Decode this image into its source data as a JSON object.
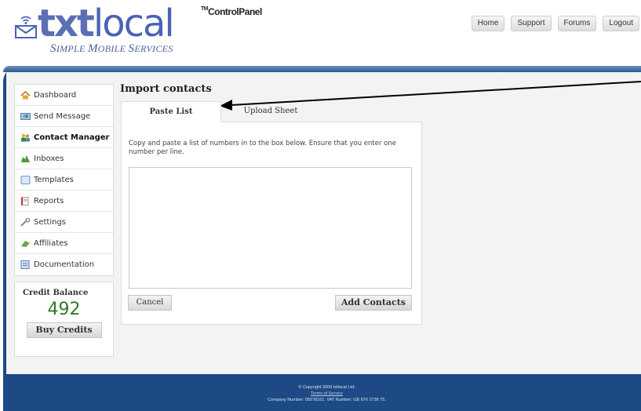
{
  "logo": {
    "brand_bold": "txt",
    "brand_light": "local",
    "product": "ControlPanel",
    "product_prefix": "TM",
    "tagline_s": "S",
    "tagline_1": "IMPLE ",
    "tagline_m": "M",
    "tagline_2": "OBILE ",
    "tagline_sv": "S",
    "tagline_3": "ERVICES"
  },
  "topnav": {
    "items": [
      {
        "label": "Home"
      },
      {
        "label": "Support"
      },
      {
        "label": "Forums"
      },
      {
        "label": "Logout"
      }
    ]
  },
  "sidebar": {
    "items": [
      {
        "label": "Dashboard",
        "icon": "home-icon"
      },
      {
        "label": "Send Message",
        "icon": "send-message-icon"
      },
      {
        "label": "Contact Manager",
        "icon": "contacts-icon",
        "active": true
      },
      {
        "label": "Inboxes",
        "icon": "inbox-icon"
      },
      {
        "label": "Templates",
        "icon": "template-icon"
      },
      {
        "label": "Reports",
        "icon": "report-icon"
      },
      {
        "label": "Settings",
        "icon": "wrench-icon"
      },
      {
        "label": "Affiliates",
        "icon": "affiliate-icon"
      },
      {
        "label": "Documentation",
        "icon": "documentation-icon"
      }
    ]
  },
  "credit": {
    "title": "Credit Balance",
    "value": "492",
    "buy_label": "Buy Credits"
  },
  "main": {
    "title": "Import contacts",
    "tabs": [
      {
        "label": "Paste List",
        "active": true
      },
      {
        "label": "Upload Sheet",
        "active": false
      }
    ],
    "instructions": "Copy and paste a list of numbers in to the box below. Ensure that you enter one number per line.",
    "textarea_value": "",
    "cancel_label": "Cancel",
    "add_label": "Add Contacts"
  },
  "footer": {
    "copyright": "© Copyright 2009 txtlocal Ltd.",
    "terms": "Terms of Service",
    "company": "Company Number: 05578161. VAT Number: GB 876 2738 75."
  },
  "colors": {
    "brand": "#5b6fb4",
    "frame": "#1d4a84",
    "credit": "#2e7a2e"
  }
}
